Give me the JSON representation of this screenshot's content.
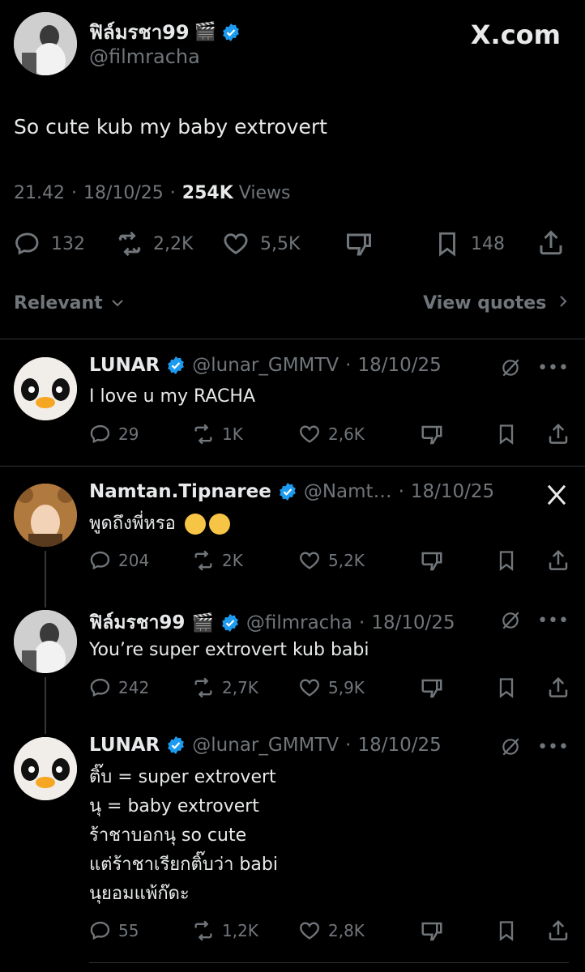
{
  "site": "X.com",
  "main_tweet": {
    "name": "ฟิล์มรชา99",
    "handle": "@filmracha",
    "text": "So cute kub my baby extrovert",
    "time": "21.42",
    "date": "18/10/25",
    "views_count": "254K",
    "views_label": "Views",
    "replies": "132",
    "reposts": "2,2K",
    "likes": "5,5K",
    "bookmarks": "148"
  },
  "tabs": {
    "left": "Relevant",
    "right": "View quotes"
  },
  "replies": [
    {
      "name": "LUNAR",
      "handle": "@lunar_GMMTV",
      "date": "18/10/25",
      "lines": [
        "I love u my RACHA"
      ],
      "replies": "29",
      "reposts": "1K",
      "likes": "2,6K"
    },
    {
      "name": "Namtan.Tipnaree",
      "handle": "@Namt…",
      "date": "18/10/25",
      "lines": [
        "พูดถึงพี่หรอ"
      ],
      "replies": "204",
      "reposts": "2K",
      "likes": "5,2K"
    },
    {
      "name": "ฟิล์มรชา99",
      "handle": "@filmracha",
      "date": "18/10/25",
      "lines": [
        "You’re super extrovert kub babi"
      ],
      "replies": "242",
      "reposts": "2,7K",
      "likes": "5,9K"
    },
    {
      "name": "LUNAR",
      "handle": "@lunar_GMMTV",
      "date": "18/10/25",
      "lines": [
        "ติ๊บ = super extrovert",
        "นุ = baby extrovert",
        "ร้าชาบอกนุ so cute",
        "แต่ร้าชาเรียกติ๊บว่า babi",
        "นุยอมแพ้ก๊ดะ"
      ],
      "replies": "55",
      "reposts": "1,2K",
      "likes": "2,8K"
    }
  ],
  "separator": "·",
  "colors": {
    "background": "#000000",
    "text": "#e7e9ea",
    "muted": "#71767b",
    "verified": "#1d9bf0",
    "divider": "#2f3336"
  }
}
